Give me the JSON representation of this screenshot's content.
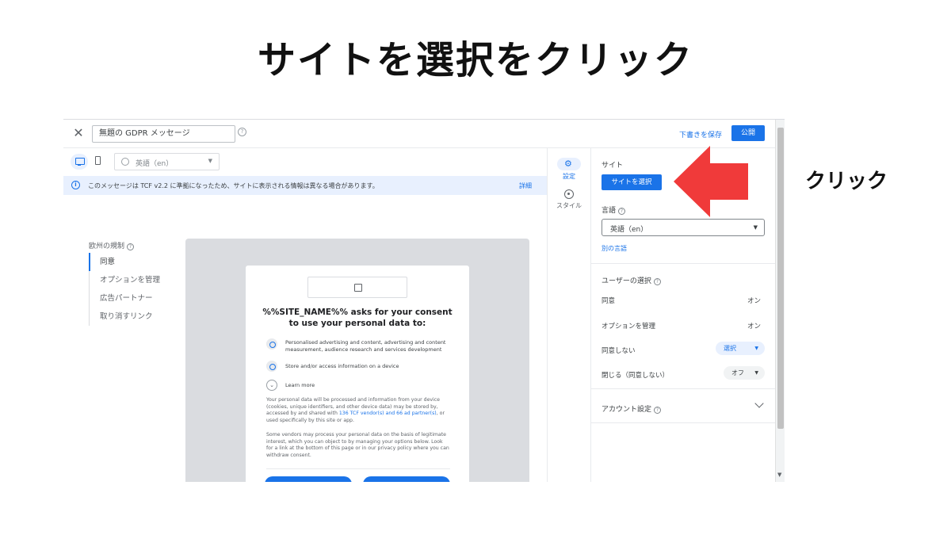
{
  "annotation": {
    "headline": "サイトを選択をクリック",
    "side_note": "クリック",
    "arrow_color": "#f03a3a"
  },
  "topbar": {
    "message_title": "無題の GDPR メッセージ",
    "save_draft": "下書きを保存",
    "publish": "公開"
  },
  "toolbar": {
    "language_value": "英語（en）"
  },
  "banner": {
    "message": "このメッセージは TCF v2.2 に準拠になったため、サイトに表示される情報は異なる場合があります。",
    "details": "詳細"
  },
  "left_nav": {
    "title": "欧州の規制",
    "items": [
      {
        "label": "同意",
        "active": true
      },
      {
        "label": "オプションを管理",
        "active": false
      },
      {
        "label": "広告パートナー",
        "active": false
      },
      {
        "label": "取り消すリンク",
        "active": false
      }
    ]
  },
  "preview": {
    "title": "%%SITE_NAME%% asks for your consent to use your personal data to:",
    "purposes": [
      "Personalised advertising and content, advertising and content measurement, audience research and services development",
      "Store and/or access information on a device"
    ],
    "learn_more": "Learn more",
    "body_1_before": "Your personal data will be processed and information from your device (cookies, unique identifiers, and other device data) may be stored by, accessed by and shared with ",
    "body_1_link": "136 TCF vendor(s) and 66 ad partner(s)",
    "body_1_after": ", or used specifically by this site or app.",
    "body_2": "Some vendors may process your personal data on the basis of legitimate interest, which you can object to by managing your options below. Look for a link at the bottom of this page or in our privacy policy where you can withdraw consent."
  },
  "rail": {
    "settings": "設定",
    "style": "スタイル"
  },
  "panel": {
    "site_label": "サイト",
    "select_site": "サイトを選択",
    "language_label": "言語",
    "language_value": "英語（en）",
    "other_language": "別の言語",
    "user_choice_label": "ユーザーの選択",
    "rows": [
      {
        "label": "同意",
        "value": "オン"
      },
      {
        "label": "オプションを管理",
        "value": "オン"
      },
      {
        "label": "同意しない",
        "value": "選択"
      },
      {
        "label": "閉じる（同意しない）",
        "value": "オフ"
      }
    ],
    "account_settings": "アカウント設定"
  }
}
